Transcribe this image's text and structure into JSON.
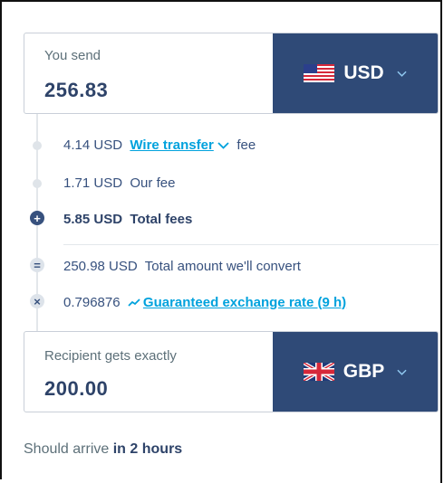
{
  "send": {
    "label": "You send",
    "amount": "256.83",
    "currency": "USD",
    "flag_icon": "us-flag-icon"
  },
  "fees": {
    "wire_amount": "4.14 USD",
    "wire_method": "Wire transfer",
    "wire_suffix": "fee",
    "our_fee_amount": "1.71 USD",
    "our_fee_label": "Our fee",
    "total_amount": "5.85 USD",
    "total_label": "Total fees",
    "convert_amount": "250.98 USD",
    "convert_label": "Total amount we'll convert",
    "rate_value": "0.796876",
    "rate_label": "Guaranteed exchange rate (9 h)"
  },
  "receive": {
    "label": "Recipient gets exactly",
    "amount": "200.00",
    "currency": "GBP",
    "flag_icon": "uk-flag-icon"
  },
  "arrival": {
    "prefix": "Should arrive",
    "time": "in 2 hours"
  },
  "colors": {
    "accent": "#2f4a77",
    "link": "#00a2dd",
    "text": "#37517e"
  }
}
